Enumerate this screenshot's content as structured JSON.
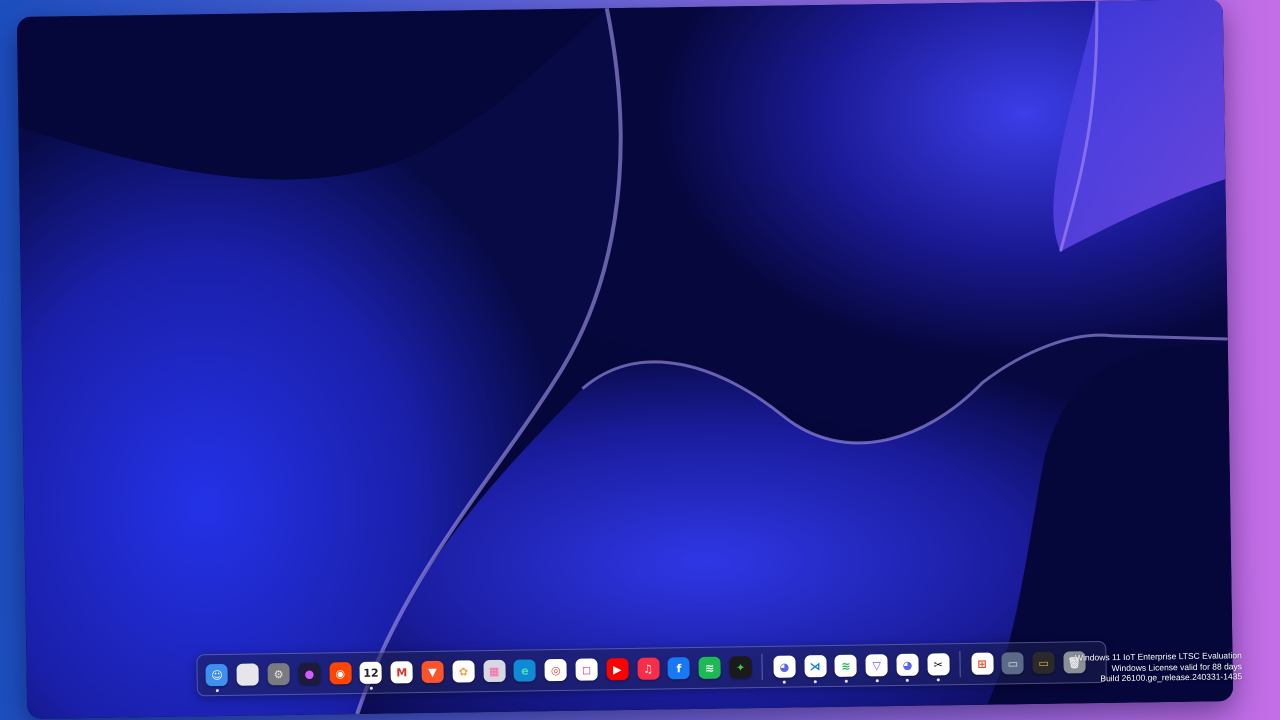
{
  "colors": {
    "frame_left": "#1d4fc0",
    "frame_right": "#c46de6",
    "wallpaper_dark": "#05063a",
    "wallpaper_bright": "#2432e8",
    "wallpaper_glow": "#b7a8ff"
  },
  "dock": {
    "groups": [
      {
        "items": [
          {
            "name": "finder-icon",
            "glyph": "☺",
            "bg": "#3f8ff0",
            "fg": "#ffffff",
            "running": true
          },
          {
            "name": "launchpad-icon",
            "glyph": "",
            "bg": "#e6e6ea",
            "fg": "#888888",
            "running": false
          },
          {
            "name": "settings-gear-icon",
            "glyph": "⚙",
            "bg": "#7a7a80",
            "fg": "#e8e8e8",
            "running": false
          },
          {
            "name": "siri-icon",
            "glyph": "●",
            "bg": "#1c1c3a",
            "fg": "#d35cff",
            "running": false
          },
          {
            "name": "reddit-icon",
            "glyph": "◉",
            "bg": "#ff4500",
            "fg": "#ffffff",
            "running": false
          },
          {
            "name": "calendar-icon",
            "glyph": "12",
            "bg": "#ffffff",
            "fg": "#222222",
            "running": true
          },
          {
            "name": "gmail-icon",
            "glyph": "M",
            "bg": "#ffffff",
            "fg": "#d93025",
            "running": false
          },
          {
            "name": "brave-icon",
            "glyph": "▼",
            "bg": "#fb542b",
            "fg": "#ffffff",
            "running": false
          },
          {
            "name": "photos-icon",
            "glyph": "✿",
            "bg": "#ffffff",
            "fg": "#f2a23a",
            "running": false
          },
          {
            "name": "app-grid-icon",
            "glyph": "▦",
            "bg": "#d8d8e2",
            "fg": "#ff5f9e",
            "running": false
          },
          {
            "name": "edge-icon",
            "glyph": "e",
            "bg": "#0f8bd6",
            "fg": "#4be0a8",
            "running": false
          },
          {
            "name": "chrome-icon",
            "glyph": "◎",
            "bg": "#ffffff",
            "fg": "#db4437",
            "running": false
          },
          {
            "name": "instagram-icon",
            "glyph": "◻",
            "bg": "#ffffff",
            "fg": "#c13584",
            "running": false
          },
          {
            "name": "youtube-icon",
            "glyph": "▶",
            "bg": "#ff0000",
            "fg": "#ffffff",
            "running": false
          },
          {
            "name": "music-icon",
            "glyph": "♫",
            "bg": "#fa2d48",
            "fg": "#ffffff",
            "running": false
          },
          {
            "name": "facebook-icon",
            "glyph": "f",
            "bg": "#1877f2",
            "fg": "#ffffff",
            "running": false
          },
          {
            "name": "spotify-icon",
            "glyph": "≋",
            "bg": "#1db954",
            "fg": "#ffffff",
            "running": false
          },
          {
            "name": "xbox-icon",
            "glyph": "✦",
            "bg": "#1a1a1a",
            "fg": "#38c94b",
            "running": false
          }
        ]
      },
      {
        "items": [
          {
            "name": "discord-icon",
            "glyph": "◕",
            "bg": "#ffffff",
            "fg": "#5865f2",
            "running": true
          },
          {
            "name": "vscode-icon",
            "glyph": "⋊",
            "bg": "#ffffff",
            "fg": "#0078d4",
            "running": true
          },
          {
            "name": "spotify-icon",
            "glyph": "≋",
            "bg": "#ffffff",
            "fg": "#1db954",
            "running": true
          },
          {
            "name": "proton-vpn-icon",
            "glyph": "▽",
            "bg": "#ffffff",
            "fg": "#6d4aff",
            "running": true
          },
          {
            "name": "discord-icon",
            "glyph": "◕",
            "bg": "#ffffff",
            "fg": "#5865f2",
            "running": true
          },
          {
            "name": "capcut-icon",
            "glyph": "✂",
            "bg": "#ffffff",
            "fg": "#111111",
            "running": true
          }
        ]
      },
      {
        "items": [
          {
            "name": "windows-start-icon",
            "glyph": "⊞",
            "bg": "#ffffff",
            "fg": "#e2452b",
            "running": false
          },
          {
            "name": "window-thumbnail-icon",
            "glyph": "▭",
            "bg": "#5a6a88",
            "fg": "#dfe4f0",
            "running": false
          },
          {
            "name": "window-thumbnail-icon",
            "glyph": "▭",
            "bg": "#2a2a2a",
            "fg": "#d9b44a",
            "running": false
          },
          {
            "name": "trash-icon",
            "glyph": "🗑",
            "bg": "#8a8f98",
            "fg": "#e6e6e6",
            "running": false
          }
        ]
      }
    ]
  },
  "watermark": {
    "line1": "Windows 11 IoT Enterprise LTSC Evaluation",
    "line2": "Windows License valid for 88 days",
    "line3": "Build 26100.ge_release.240331-1435"
  }
}
